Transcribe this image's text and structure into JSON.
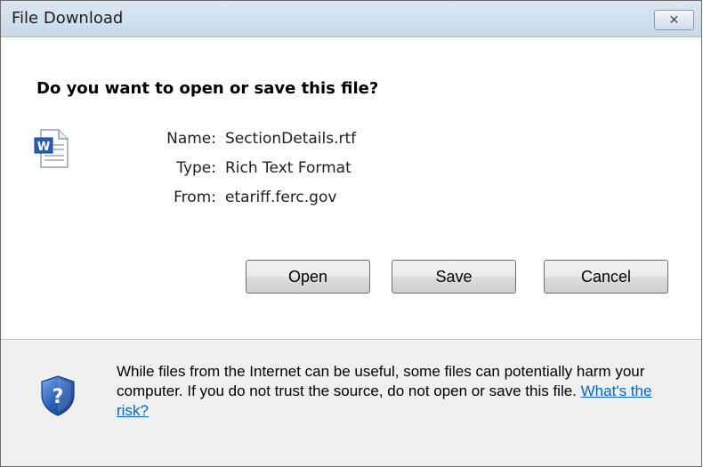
{
  "window": {
    "title": "File Download",
    "close_label": "✕"
  },
  "dialog": {
    "question": "Do you want to open or save this file?",
    "file_icon": "word-document-icon",
    "fields": [
      {
        "label": "Name:",
        "value": "SectionDetails.rtf"
      },
      {
        "label": "Type:",
        "value": "Rich Text Format"
      },
      {
        "label": "From:",
        "value": "etariff.ferc.gov"
      }
    ],
    "buttons": {
      "open": "Open",
      "save": "Save",
      "cancel": "Cancel"
    }
  },
  "footer": {
    "icon": "security-shield-icon",
    "warning_text": "While files from the Internet can be useful, some files can potentially harm your computer. If you do not trust the source, do not open or save this file.",
    "risk_link": "What's the risk?"
  },
  "colors": {
    "link": "#0066cc",
    "shield": "#2a5fb5"
  }
}
